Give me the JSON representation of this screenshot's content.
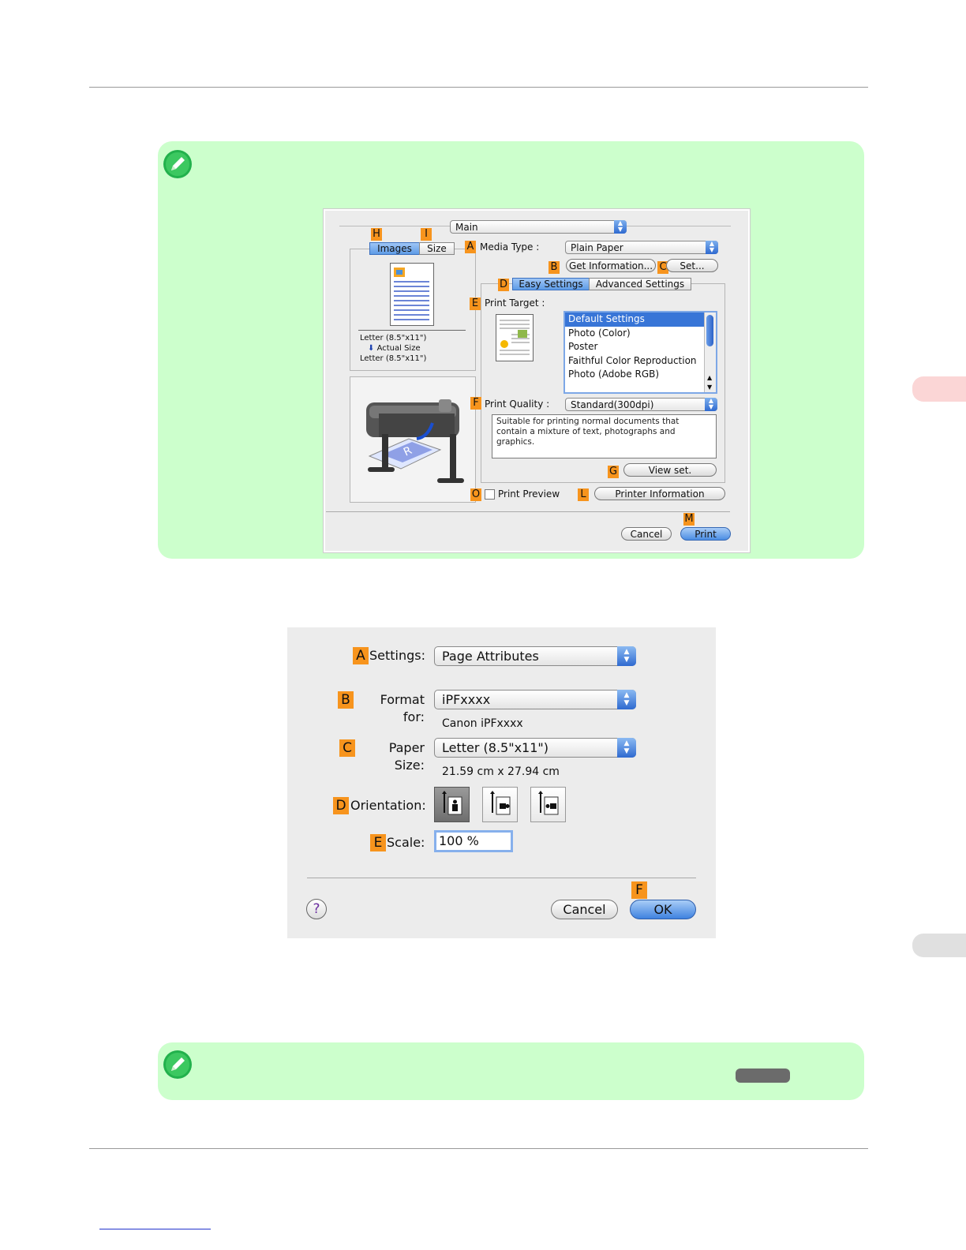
{
  "note1": {
    "icon": "pencil-note-icon"
  },
  "driver_dialog": {
    "panel_popup": "Main",
    "callouts": {
      "A": "A",
      "B": "B",
      "C": "C",
      "D": "D",
      "E": "E",
      "F": "F",
      "G": "G",
      "H": "H",
      "I": "I",
      "L": "L",
      "M": "M",
      "O": "O"
    },
    "tabs_left": [
      "Images",
      "Size"
    ],
    "paper_info": [
      "Letter (8.5\"x11\")",
      "Actual Size",
      "Letter (8.5\"x11\")"
    ],
    "media_type_label": "Media Type :",
    "media_type_value": "Plain Paper",
    "get_information": "Get Information...",
    "set": "Set...",
    "tabs_right": [
      "Easy Settings",
      "Advanced Settings"
    ],
    "print_target_label": "Print Target :",
    "print_targets": [
      "Default Settings",
      "Photo (Color)",
      "Poster",
      "Faithful Color Reproduction",
      "Photo (Adobe RGB)"
    ],
    "print_quality_label": "Print Quality :",
    "print_quality_value": "Standard(300dpi)",
    "quality_description": "Suitable for printing normal documents that contain a mixture of text, photographs and graphics.",
    "view_set": "View set.",
    "print_preview": "Print Preview",
    "printer_information": "Printer Information",
    "cancel": "Cancel",
    "print": "Print"
  },
  "page_setup": {
    "callouts": {
      "A": "A",
      "B": "B",
      "C": "C",
      "D": "D",
      "E": "E",
      "F": "F"
    },
    "settings_label": "Settings:",
    "settings_value": "Page Attributes",
    "format_for_label": "Format for:",
    "format_for_value": "iPFxxxx",
    "format_for_sub": "Canon iPFxxxx",
    "paper_size_label": "Paper Size:",
    "paper_size_value": "Letter (8.5\"x11\")",
    "paper_size_sub": "21.59 cm x 27.94 cm",
    "orientation_label": "Orientation:",
    "scale_label": "Scale:",
    "scale_value": "100 %",
    "help": "?",
    "cancel": "Cancel",
    "ok": "OK"
  },
  "note2": {
    "icon": "pencil-note-icon"
  }
}
